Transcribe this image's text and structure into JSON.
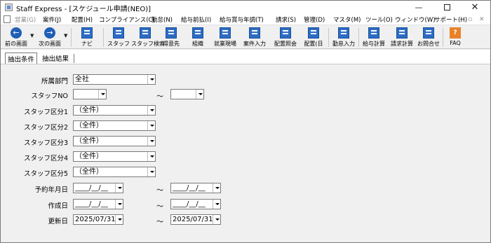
{
  "window": {
    "title": "Staff Express - [スケジュール申請(NEO)]"
  },
  "menu": [
    {
      "label": "営業(G)",
      "disabled": true
    },
    {
      "label": "案件(J)",
      "disabled": false
    },
    {
      "label": "配置(H)",
      "disabled": false
    },
    {
      "label": "コンプライアンス(C)",
      "disabled": false
    },
    {
      "label": "勤怠(N)",
      "disabled": false
    },
    {
      "label": "給与前払(I)",
      "disabled": false
    },
    {
      "label": "給与賞与年調(T)",
      "disabled": false
    },
    {
      "label": "請求(S)",
      "disabled": false
    },
    {
      "label": "管理(D)",
      "disabled": false
    },
    {
      "label": "マスタ(M)",
      "disabled": false
    },
    {
      "label": "ツール(O)",
      "disabled": false
    },
    {
      "label": "ウィンドウ(W)",
      "disabled": false
    },
    {
      "label": "サポート(H)",
      "disabled": false
    }
  ],
  "toolbar": {
    "prev": "前の画面",
    "next": "次の画面",
    "navi": "ナビ",
    "staff": "スタッフ",
    "staff_search": "スタッフ検索",
    "client": "得意先",
    "org": "組織",
    "workplace": "就業現場",
    "case_input": "案件入力",
    "assign_inquiry": "配置照会",
    "assign_day": "配置(日",
    "attendance_input": "勤怠入力",
    "payroll_calc": "給与計算",
    "billing_calc": "請求計算",
    "contact": "お問合せ",
    "faq": "FAQ"
  },
  "tabs": {
    "conditions": "抽出条件",
    "results": "抽出結果"
  },
  "form": {
    "dept_label": "所属部門",
    "dept_value": "全社",
    "staff_no_label": "スタッフNO",
    "staff_no_from": "",
    "staff_no_to": "",
    "range_sep": "～",
    "cat1_label": "スタッフ区分1",
    "cat2_label": "スタッフ区分2",
    "cat3_label": "スタッフ区分3",
    "cat4_label": "スタッフ区分4",
    "cat5_label": "スタッフ区分5",
    "cat_all": "（全件）",
    "reserve_label": "予約年月日",
    "reserve_from": "____/__/__",
    "reserve_to": "____/__/__",
    "created_label": "作成日",
    "created_from": "____/__/__",
    "created_to": "____/__/__",
    "updated_label": "更新日",
    "updated_from": "2025/07/31",
    "updated_to": "2025/07/31"
  }
}
